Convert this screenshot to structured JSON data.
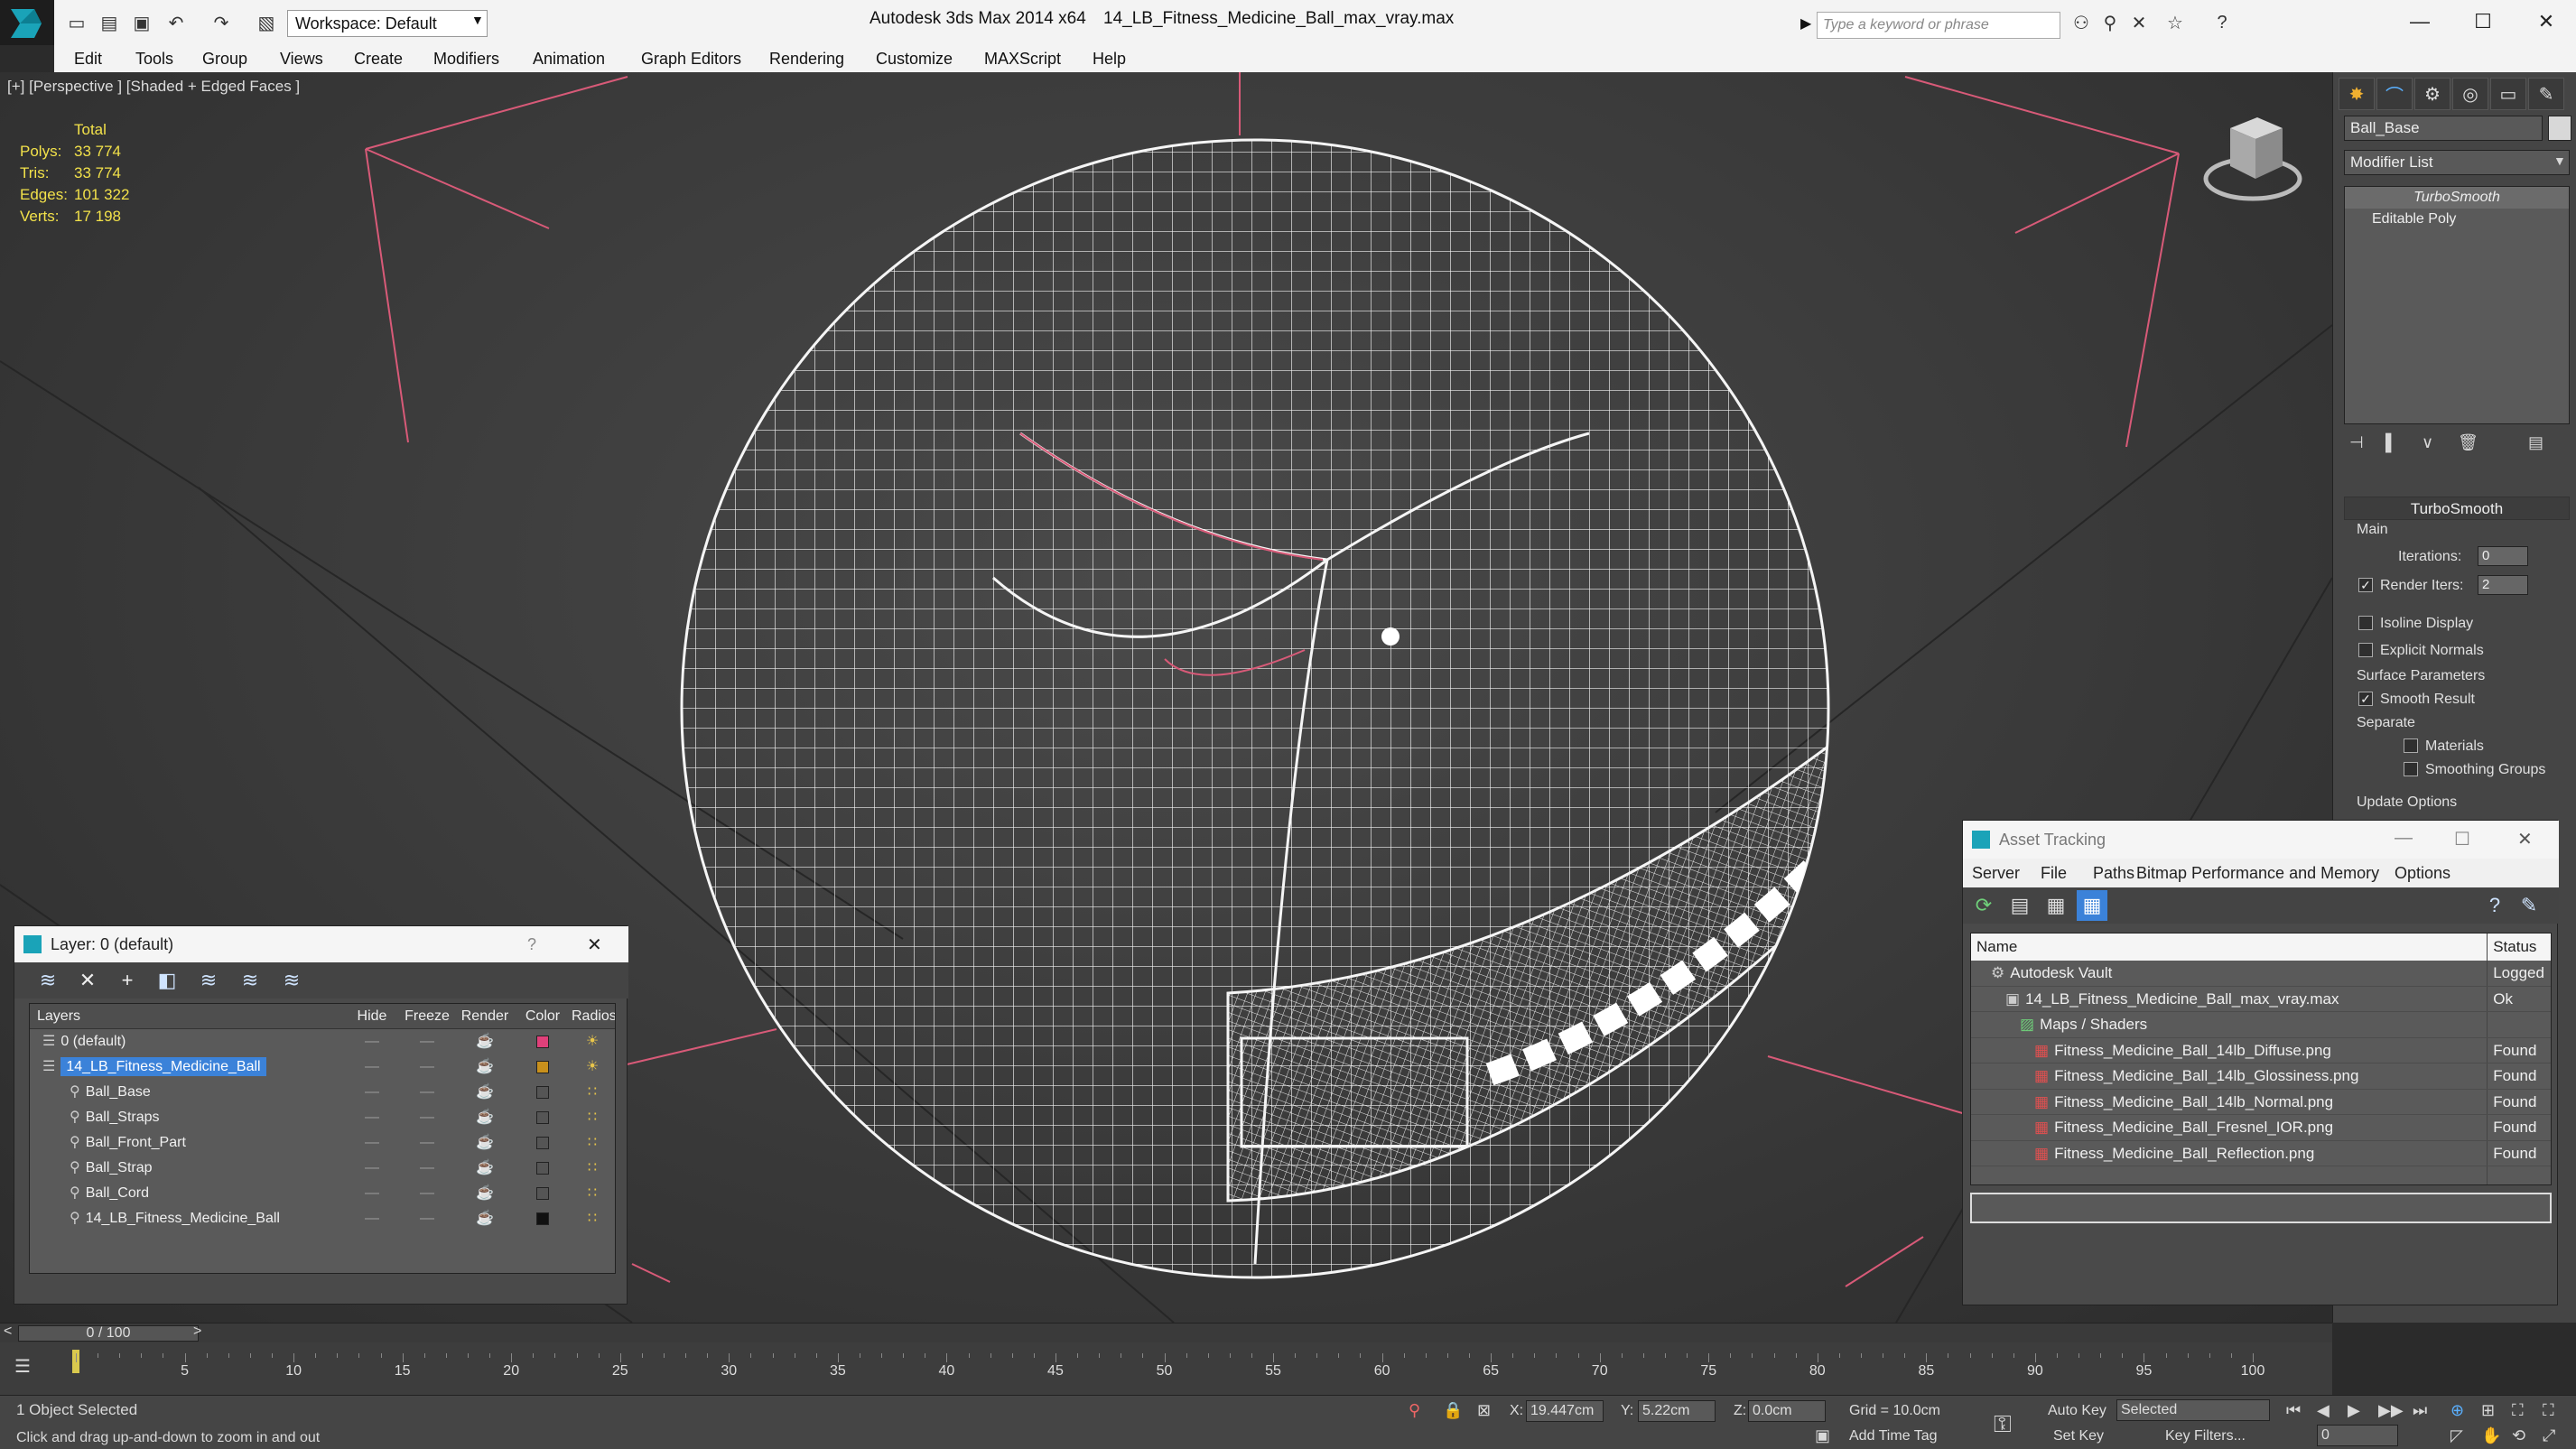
{
  "titlebar": {
    "workspace": "Workspace: Default",
    "app_title": "Autodesk 3ds Max  2014 x64",
    "file_title": "14_LB_Fitness_Medicine_Ball_max_vray.max",
    "search_placeholder": "Type a keyword or phrase"
  },
  "menu": [
    "Edit",
    "Tools",
    "Group",
    "Views",
    "Create",
    "Modifiers",
    "Animation",
    "Graph Editors",
    "Rendering",
    "Customize",
    "MAXScript",
    "Help"
  ],
  "viewport": {
    "label": "[+] [Perspective ] [Shaded + Edged Faces ]",
    "stats_header": "Total",
    "stats": [
      {
        "k": "Polys:",
        "v": "33 774"
      },
      {
        "k": "Tris:",
        "v": "33 774"
      },
      {
        "k": "Edges:",
        "v": "101 322"
      },
      {
        "k": "Verts:",
        "v": "17 198"
      }
    ]
  },
  "command_panel": {
    "object_name": "Ball_Base",
    "modifier_list": "Modifier List",
    "stack": [
      "TurboSmooth",
      "Editable Poly"
    ],
    "turbosmooth": {
      "title": "TurboSmooth",
      "main": "Main",
      "iterations_label": "Iterations:",
      "iterations_value": "0",
      "render_iters_label": "Render Iters:",
      "render_iters_value": "2",
      "isoline": "Isoline Display",
      "explicit_normals": "Explicit Normals",
      "surface_params": "Surface Parameters",
      "smooth_result": "Smooth Result",
      "separate": "Separate",
      "materials": "Materials",
      "smoothing_groups": "Smoothing Groups",
      "update_options": "Update Options"
    }
  },
  "layer_dialog": {
    "title": "Layer: 0 (default)",
    "help": "?",
    "columns": [
      "Layers",
      "Hide",
      "Freeze",
      "Render",
      "Color",
      "Radiosit"
    ],
    "rows": [
      {
        "name": "0 (default)",
        "indent": 0,
        "color": "#e0407a",
        "active": true
      },
      {
        "name": "14_LB_Fitness_Medicine_Ball",
        "indent": 0,
        "color": "#c8901c",
        "selected": true
      },
      {
        "name": "Ball_Base",
        "indent": 1,
        "color": "#555555"
      },
      {
        "name": "Ball_Straps",
        "indent": 1,
        "color": "#555555"
      },
      {
        "name": "Ball_Front_Part",
        "indent": 1,
        "color": "#555555"
      },
      {
        "name": "Ball_Strap",
        "indent": 1,
        "color": "#555555"
      },
      {
        "name": "Ball_Cord",
        "indent": 1,
        "color": "#555555"
      },
      {
        "name": "14_LB_Fitness_Medicine_Ball",
        "indent": 1,
        "color": "#111111"
      }
    ]
  },
  "asset_dialog": {
    "title": "Asset Tracking",
    "menu": [
      "Server",
      "File",
      "Paths",
      "Bitmap Performance and Memory",
      "Options"
    ],
    "columns": [
      "Name",
      "Status"
    ],
    "rows": [
      {
        "name": "Autodesk Vault",
        "indent": 1,
        "status": "Logged"
      },
      {
        "name": "14_LB_Fitness_Medicine_Ball_max_vray.max",
        "indent": 2,
        "status": "Ok"
      },
      {
        "name": "Maps / Shaders",
        "indent": 3,
        "status": ""
      },
      {
        "name": "Fitness_Medicine_Ball_14lb_Diffuse.png",
        "indent": 4,
        "status": "Found"
      },
      {
        "name": "Fitness_Medicine_Ball_14lb_Glossiness.png",
        "indent": 4,
        "status": "Found"
      },
      {
        "name": "Fitness_Medicine_Ball_14lb_Normal.png",
        "indent": 4,
        "status": "Found"
      },
      {
        "name": "Fitness_Medicine_Ball_Fresnel_IOR.png",
        "indent": 4,
        "status": "Found"
      },
      {
        "name": "Fitness_Medicine_Ball_Reflection.png",
        "indent": 4,
        "status": "Found"
      }
    ]
  },
  "timeline": {
    "slider": "0 / 100",
    "ticks": [
      "5",
      "10",
      "15",
      "20",
      "25",
      "30",
      "35",
      "40",
      "45",
      "50",
      "55",
      "60",
      "65",
      "70",
      "75",
      "80",
      "85",
      "90",
      "95",
      "100"
    ]
  },
  "status": {
    "selection": "1 Object Selected",
    "prompt": "Click and drag up-and-down to zoom in and out",
    "x_label": "X:",
    "x_value": "19.447cm",
    "y_label": "Y:",
    "y_value": "5.22cm",
    "z_label": "Z:",
    "z_value": "0.0cm",
    "grid": "Grid = 10.0cm",
    "auto_key": "Auto Key",
    "set_key": "Set Key",
    "selected": "Selected",
    "key_filters": "Key Filters...",
    "add_time_tag": "Add Time Tag",
    "frame": "0"
  }
}
